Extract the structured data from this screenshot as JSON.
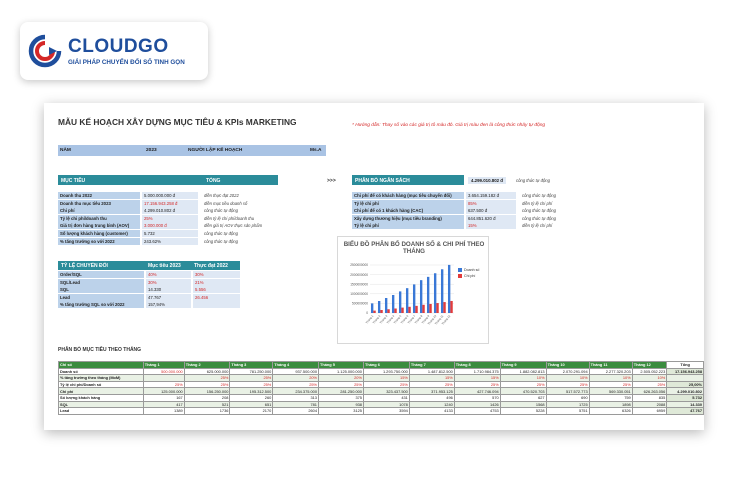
{
  "logo": {
    "name": "CLOUDGO",
    "tagline": "GIẢI PHÁP CHUYỂN ĐỔI SỐ TINH GỌN",
    "colors": {
      "blue": "#1f4e9c",
      "red": "#d42828"
    }
  },
  "sheet": {
    "title": "MẪU KẾ HOẠCH XÂY DỰNG MỤC TIÊU & KPIs MARKETING",
    "hint": "* Hướng dẫn: Thay số vào các giá trị tô màu đỏ. Giá trị màu đen là công thức nhảy tự động",
    "info": {
      "year_label": "NĂM",
      "year_value": "2023",
      "owner_label": "NGƯỜI LẬP KẾ HOẠCH",
      "owner_value": "Ms.A"
    },
    "arrows": ">>>",
    "targets": {
      "header": "MỤC TIÊU",
      "header_total": "TỔNG",
      "rows": [
        {
          "label": "Doanh thu 2022",
          "value": "5.000.000.000 đ",
          "note": "điền thực đạt 2022",
          "red": false
        },
        {
          "label": "Doanh thu mục tiêu 2023",
          "value": "17.156.943.258 đ",
          "note": "điền mục tiêu doanh số",
          "red": true
        },
        {
          "label": "Chi phí",
          "value": "4.299.010.802 đ",
          "note": "công thức tự động",
          "red": false
        },
        {
          "label": "Tỷ lệ chi phí/doanh thu",
          "value": "25%",
          "note": "điền tỷ lệ chi phí/doanh thu",
          "red": true
        },
        {
          "label": "Giá trị đơn hàng trung bình (AOV)",
          "value": "3.000.000 đ",
          "note": "điền giá trị AOV thực sản phẩm",
          "red": true
        },
        {
          "label": "Số lượng khách hàng (customer)",
          "value": "5.732",
          "note": "công thức tự động",
          "red": false
        },
        {
          "label": "% tăng trưởng so với 2022",
          "value": "243.62%",
          "note": "công thức tự động",
          "red": false
        }
      ]
    },
    "budget": {
      "header": "PHÂN BỔ NGÂN SÁCH",
      "header_value": "4.299.010.802 đ",
      "header_note": "công thức tự động",
      "rows": [
        {
          "label": "Chi phí để có khách hàng (mục tiêu chuyển đổi)",
          "value": "3.654.159.182 đ",
          "note": "công thức tự động",
          "red": false
        },
        {
          "label": "Tỷ lệ chi phí",
          "value": "85%",
          "note": "điền tỷ lệ chi phí",
          "red": true
        },
        {
          "label": "Chi phí để có 1 khách hàng (CAC)",
          "value": "637.500 đ",
          "note": "công thức tự động",
          "red": false
        },
        {
          "label": "Xây dựng thương hiệu (mục tiêu branding)",
          "value": "644.851.620 đ",
          "note": "công thức tự động",
          "red": false
        },
        {
          "label": "Tỷ lệ chi phí",
          "value": "15%",
          "note": "điền tỷ lệ chi phí",
          "red": true
        }
      ]
    },
    "conversion": {
      "h1": "TỶ LỆ CHUYỂN ĐỔI",
      "h2": "Mục tiêu 2023",
      "h3": "Thực đạt 2022",
      "rows": [
        {
          "label": "Order/SQL",
          "a": "40%",
          "b": "30%",
          "ra": true,
          "rb": true
        },
        {
          "label": "SQL/Lead",
          "a": "30%",
          "b": "21%",
          "ra": true,
          "rb": true
        },
        {
          "label": "SQL",
          "a": "14.330",
          "b": "5.556",
          "ra": false,
          "rb": true
        },
        {
          "label": "Lead",
          "a": "47.767",
          "b": "26.456",
          "ra": false,
          "rb": true
        },
        {
          "label": "% tăng trưởng SQL so với 2022",
          "a": "157,94%",
          "b": "",
          "ra": false,
          "rb": false
        }
      ]
    },
    "chart": {
      "title": "BIỂU ĐỒ PHÂN BỔ DOANH SỐ & CHI PHÍ THEO THÁNG",
      "legend": [
        "Doanh số",
        "Chi phí"
      ],
      "y_ticks": [
        "2500000000",
        "2000000000",
        "1500000000",
        "1000000000",
        "500000000",
        "0"
      ],
      "colors": {
        "doanh_so": "#3a78d6",
        "chi_phi": "#e33b3b"
      }
    },
    "monthly": {
      "section_title": "PHÂN BỔ MỤC TIÊU THEO THÁNG",
      "headers": [
        "Chỉ số",
        "Tháng 1",
        "Tháng 2",
        "Tháng 3",
        "Tháng 4",
        "Tháng 5",
        "Tháng 6",
        "Tháng 7",
        "Tháng 8",
        "Tháng 9",
        "Tháng 10",
        "Tháng 11",
        "Tháng 12",
        "Tổng"
      ],
      "rows": [
        {
          "label": "Doanh số",
          "cells": [
            "500.000.000",
            "625.000.000",
            "781.250.000",
            "937.500.000",
            "1.125.000.000",
            "1.293.750.000",
            "1.487.812.500",
            "1.710.984.375",
            "1.882.082.813",
            "2.070.291.094",
            "2.277.320.203",
            "2.505.052.223"
          ],
          "total": "17.156.943.258",
          "red_first": true
        },
        {
          "label": "% tăng trưởng theo tháng (MoM)",
          "cells": [
            "",
            "25%",
            "25%",
            "20%",
            "20%",
            "15%",
            "15%",
            "15%",
            "10%",
            "10%",
            "10%",
            "10%"
          ],
          "total": "",
          "red_first": false,
          "red_all": true
        },
        {
          "label": "Tỷ lệ chi phí/Doanh số",
          "cells": [
            "25%",
            "25%",
            "25%",
            "25%",
            "25%",
            "25%",
            "25%",
            "25%",
            "25%",
            "25%",
            "25%",
            "25%"
          ],
          "total": "25,00%",
          "red_first": false,
          "red_all": true
        },
        {
          "label": "Chi phí",
          "cells": [
            "125.000.000",
            "156.250.000",
            "195.312.500",
            "234.375.000",
            "281.250.000",
            "323.437.500",
            "371.953.125",
            "427.746.094",
            "470.520.703",
            "517.572.773",
            "569.330.051",
            "626.263.056"
          ],
          "total": "4.299.010.802",
          "red_first": false
        },
        {
          "label": "Số lượng khách hàng",
          "cells": [
            "167",
            "208",
            "260",
            "313",
            "375",
            "431",
            "496",
            "570",
            "627",
            "690",
            "759",
            "835"
          ],
          "total": "5.732",
          "red_first": false
        },
        {
          "label": "SQL",
          "cells": [
            "417",
            "521",
            "651",
            "781",
            "938",
            "1078",
            "1240",
            "1426",
            "1568",
            "1725",
            "1898",
            "2088"
          ],
          "total": "14.330",
          "red_first": false
        },
        {
          "label": "Lead",
          "cells": [
            "1389",
            "1736",
            "2170",
            "2604",
            "3125",
            "3594",
            "4133",
            "4753",
            "5228",
            "5751",
            "6326",
            "6959"
          ],
          "total": "47.767",
          "red_first": false
        }
      ]
    }
  },
  "chart_data": {
    "type": "bar",
    "title": "BIỂU ĐỒ PHÂN BỔ DOANH SỐ & CHI PHÍ THEO THÁNG",
    "categories": [
      "Tháng 1",
      "Tháng 2",
      "Tháng 3",
      "Tháng 4",
      "Tháng 5",
      "Tháng 6",
      "Tháng 7",
      "Tháng 8",
      "Tháng 9",
      "Tháng 10",
      "Tháng 11",
      "Tháng 12"
    ],
    "series": [
      {
        "name": "Doanh số",
        "values": [
          500000000,
          625000000,
          781250000,
          937500000,
          1125000000,
          1293750000,
          1487812500,
          1710984375,
          1882082813,
          2070291094,
          2277320203,
          2505052223
        ]
      },
      {
        "name": "Chi phí",
        "values": [
          125000000,
          156250000,
          195312500,
          234375000,
          281250000,
          323437500,
          371953125,
          427746094,
          470520703,
          517572773,
          569330051,
          626263056
        ]
      }
    ],
    "ylim": [
      0,
      2500000000
    ],
    "legend": "right",
    "grid": true
  }
}
